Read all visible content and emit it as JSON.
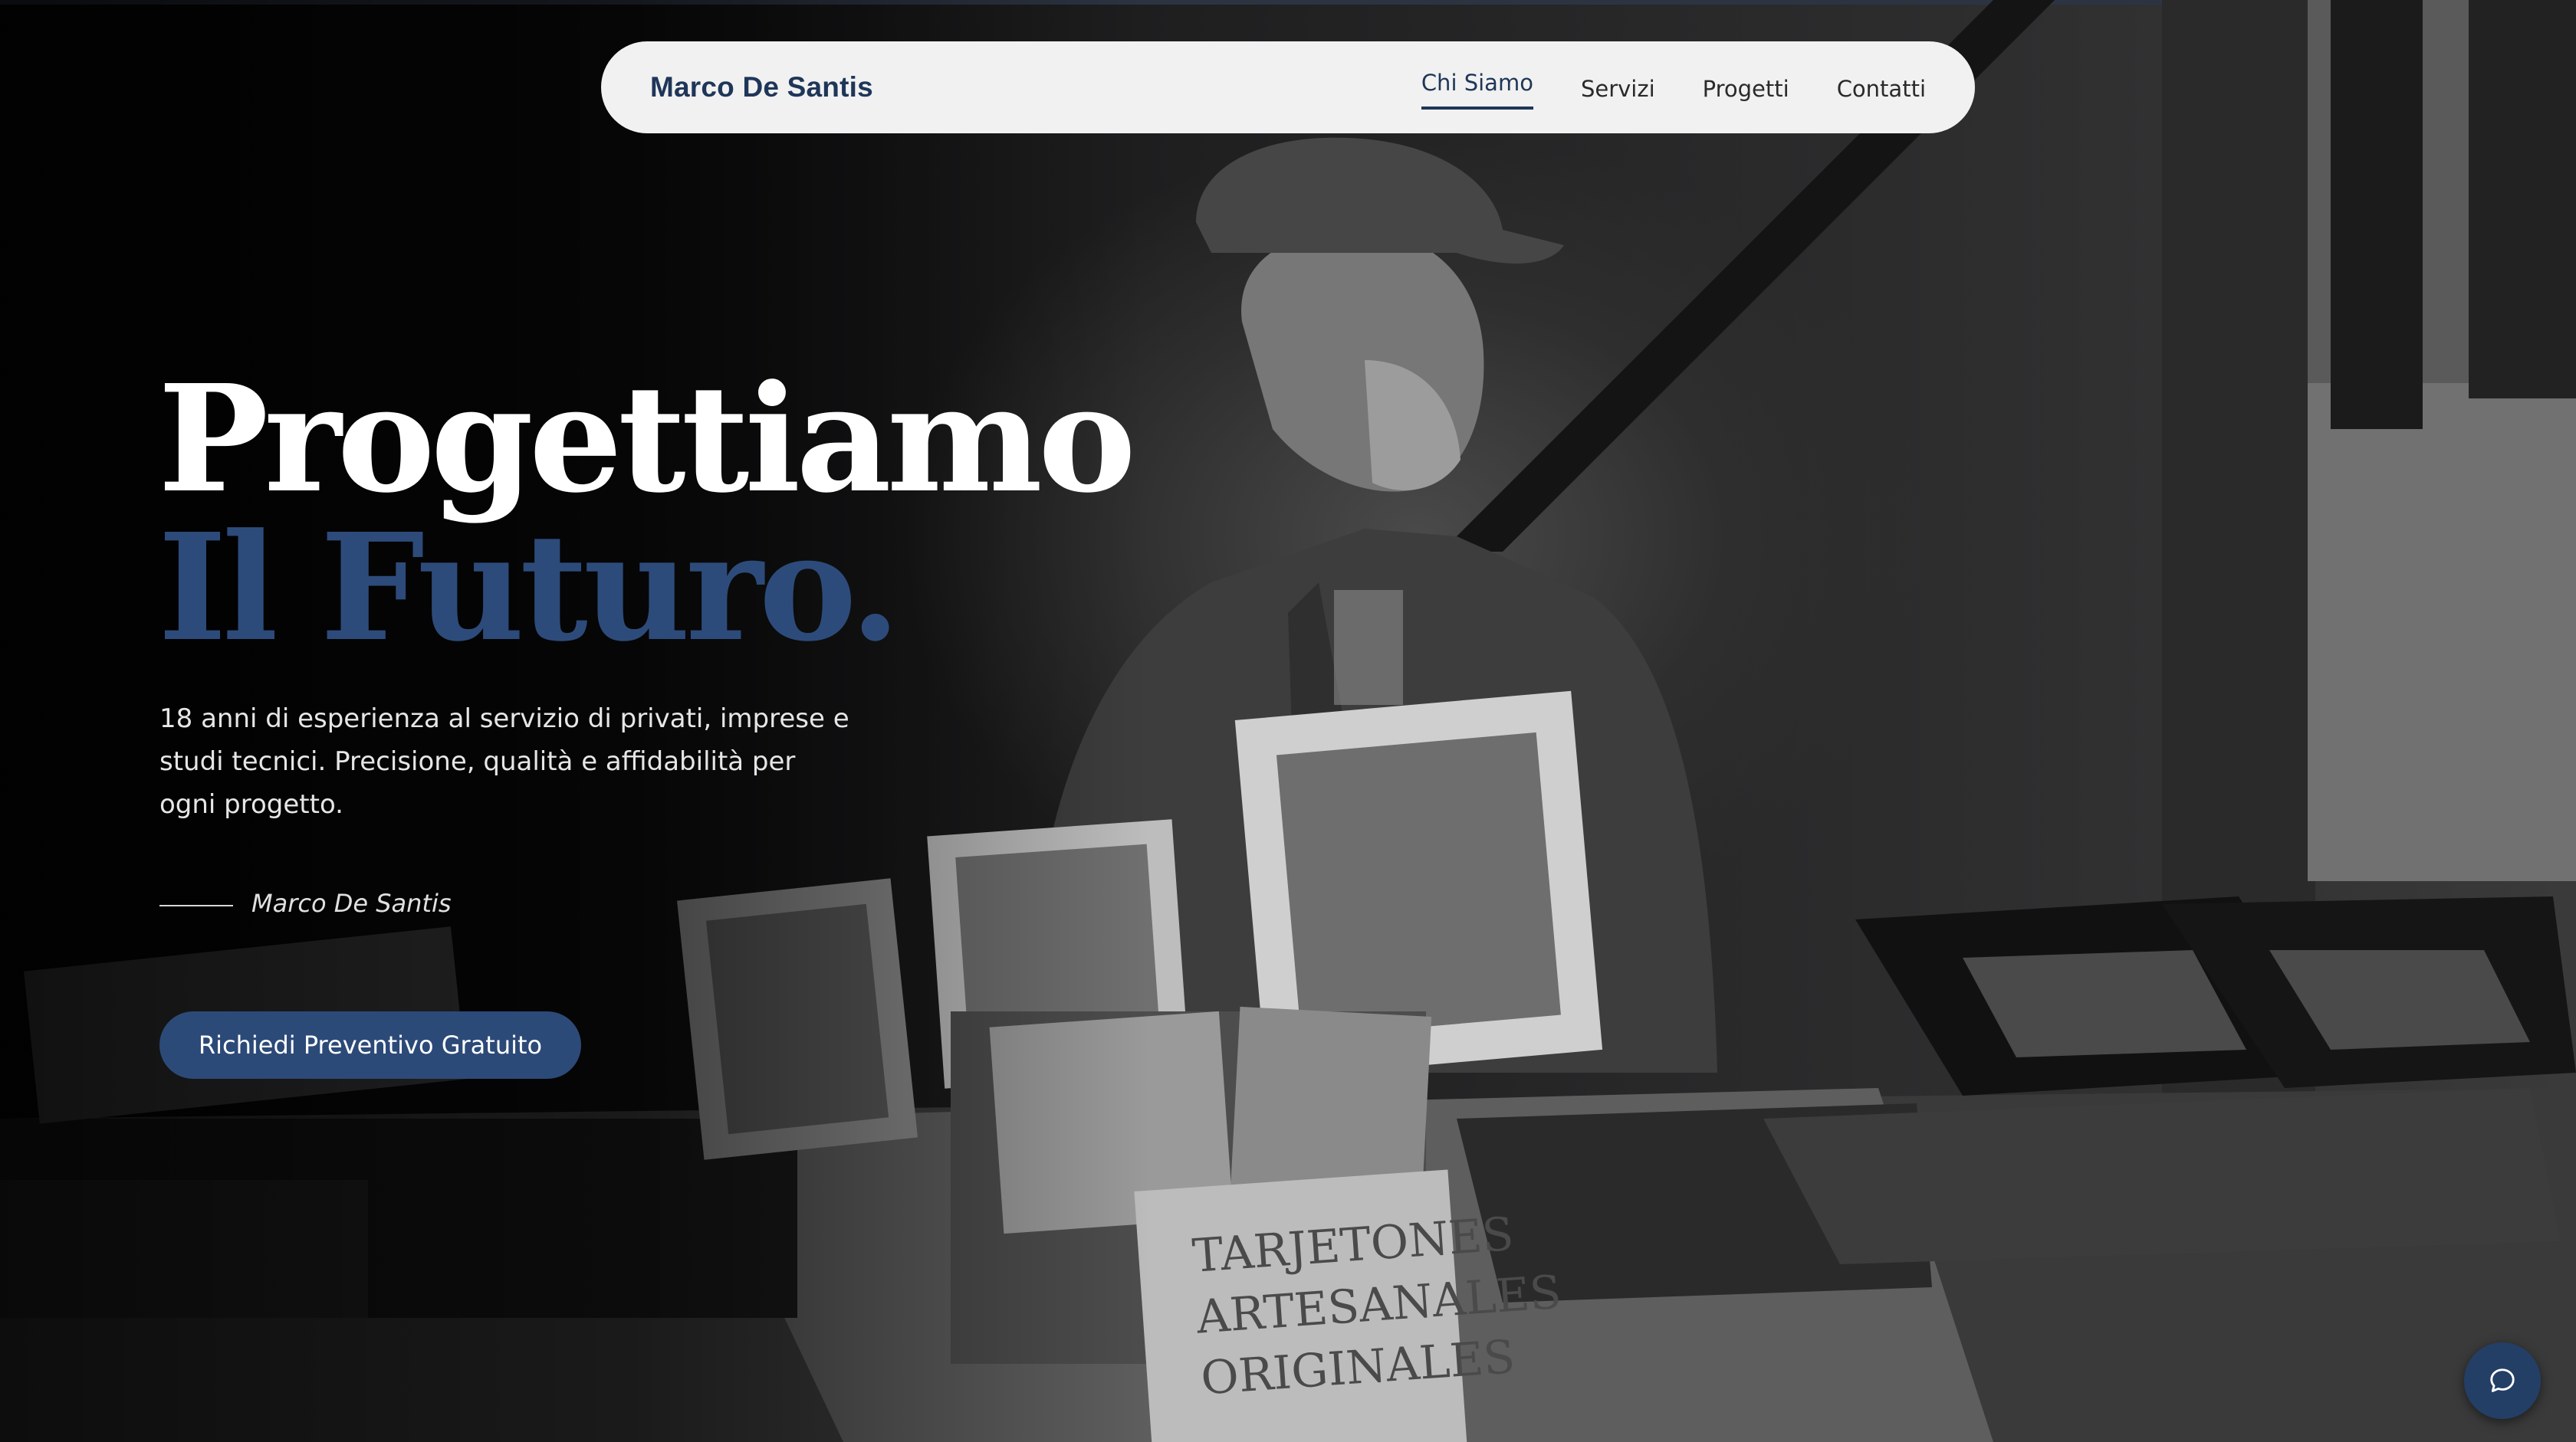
{
  "nav": {
    "brand": "Marco De Santis",
    "items": [
      {
        "label": "Chi Siamo",
        "active": true
      },
      {
        "label": "Servizi",
        "active": false
      },
      {
        "label": "Progetti",
        "active": false
      },
      {
        "label": "Contatti",
        "active": false
      }
    ]
  },
  "hero": {
    "title_line1": "Progettiamo",
    "title_line2": "Il Futuro.",
    "lead": "18 anni di esperienza al servizio di privati, imprese e studi tecnici. Precisione, qualità e affidabilità per ogni progetto.",
    "signature": "Marco De Santis",
    "cta_label": "Richiedi Preventivo Gratuito"
  },
  "image": {
    "sign_lines": [
      "TARJETONES",
      "ARTESANALES",
      "ORIGINALES"
    ]
  },
  "chat": {
    "icon": "chat-bubble-icon"
  },
  "colors": {
    "accent": "#2c4a78",
    "brand_text": "#1e3658",
    "title_accent": "#2d4b7a",
    "nav_bg": "#f1f1f1"
  }
}
